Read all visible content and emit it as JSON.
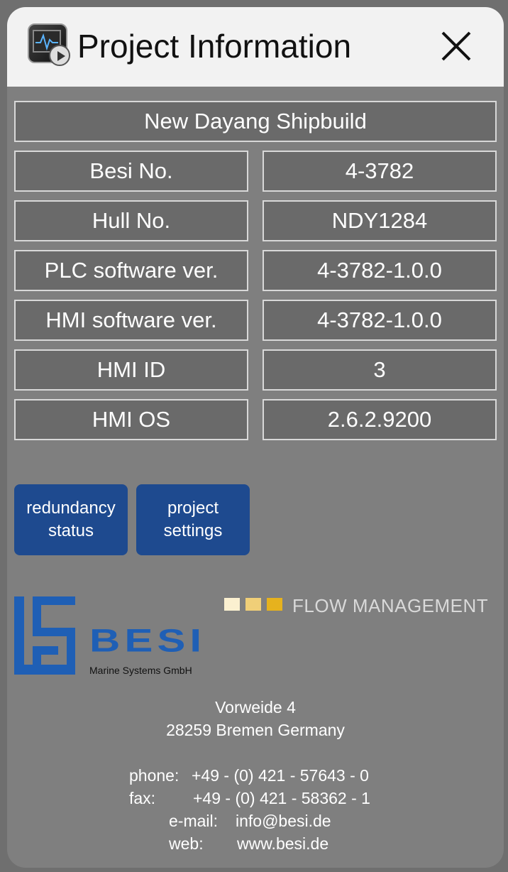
{
  "window": {
    "title": "Project Information",
    "icons": {
      "app": "monitor-play-icon",
      "close": "close-icon"
    }
  },
  "project_name": "New Dayang Shipbuild",
  "fields": [
    {
      "label": "Besi No.",
      "value": "4-3782"
    },
    {
      "label": "Hull No.",
      "value": "NDY1284"
    },
    {
      "label": "PLC software ver.",
      "value": "4-3782-1.0.0"
    },
    {
      "label": "HMI software ver.",
      "value": "4-3782-1.0.0"
    },
    {
      "label": "HMI ID",
      "value": "3"
    },
    {
      "label": "HMI OS",
      "value": "2.6.2.9200"
    }
  ],
  "buttons": {
    "redundancy": "redundancy\nstatus",
    "settings": "project\nsettings"
  },
  "branding": {
    "tagline": "FLOW MANAGEMENT",
    "logo_text": "BESI",
    "logo_sub": "Marine Systems GmbH",
    "colors": {
      "logo_blue": "#1f5fb5",
      "button_blue": "#1e4a8f",
      "sq1": "#fbf0d0",
      "sq2": "#f0cf78",
      "sq3": "#e6b21e"
    }
  },
  "address": {
    "street": "Vorweide 4",
    "city": "28259 Bremen Germany"
  },
  "contact": {
    "phone_label": "phone:",
    "phone": "+49 - (0) 421 - 57643 - 0",
    "fax_label": "fax:",
    "fax": "+49 - (0) 421 - 58362 - 1",
    "email_label": "e-mail:",
    "email": "info@besi.de",
    "web_label": "web:",
    "web": "www.besi.de"
  }
}
